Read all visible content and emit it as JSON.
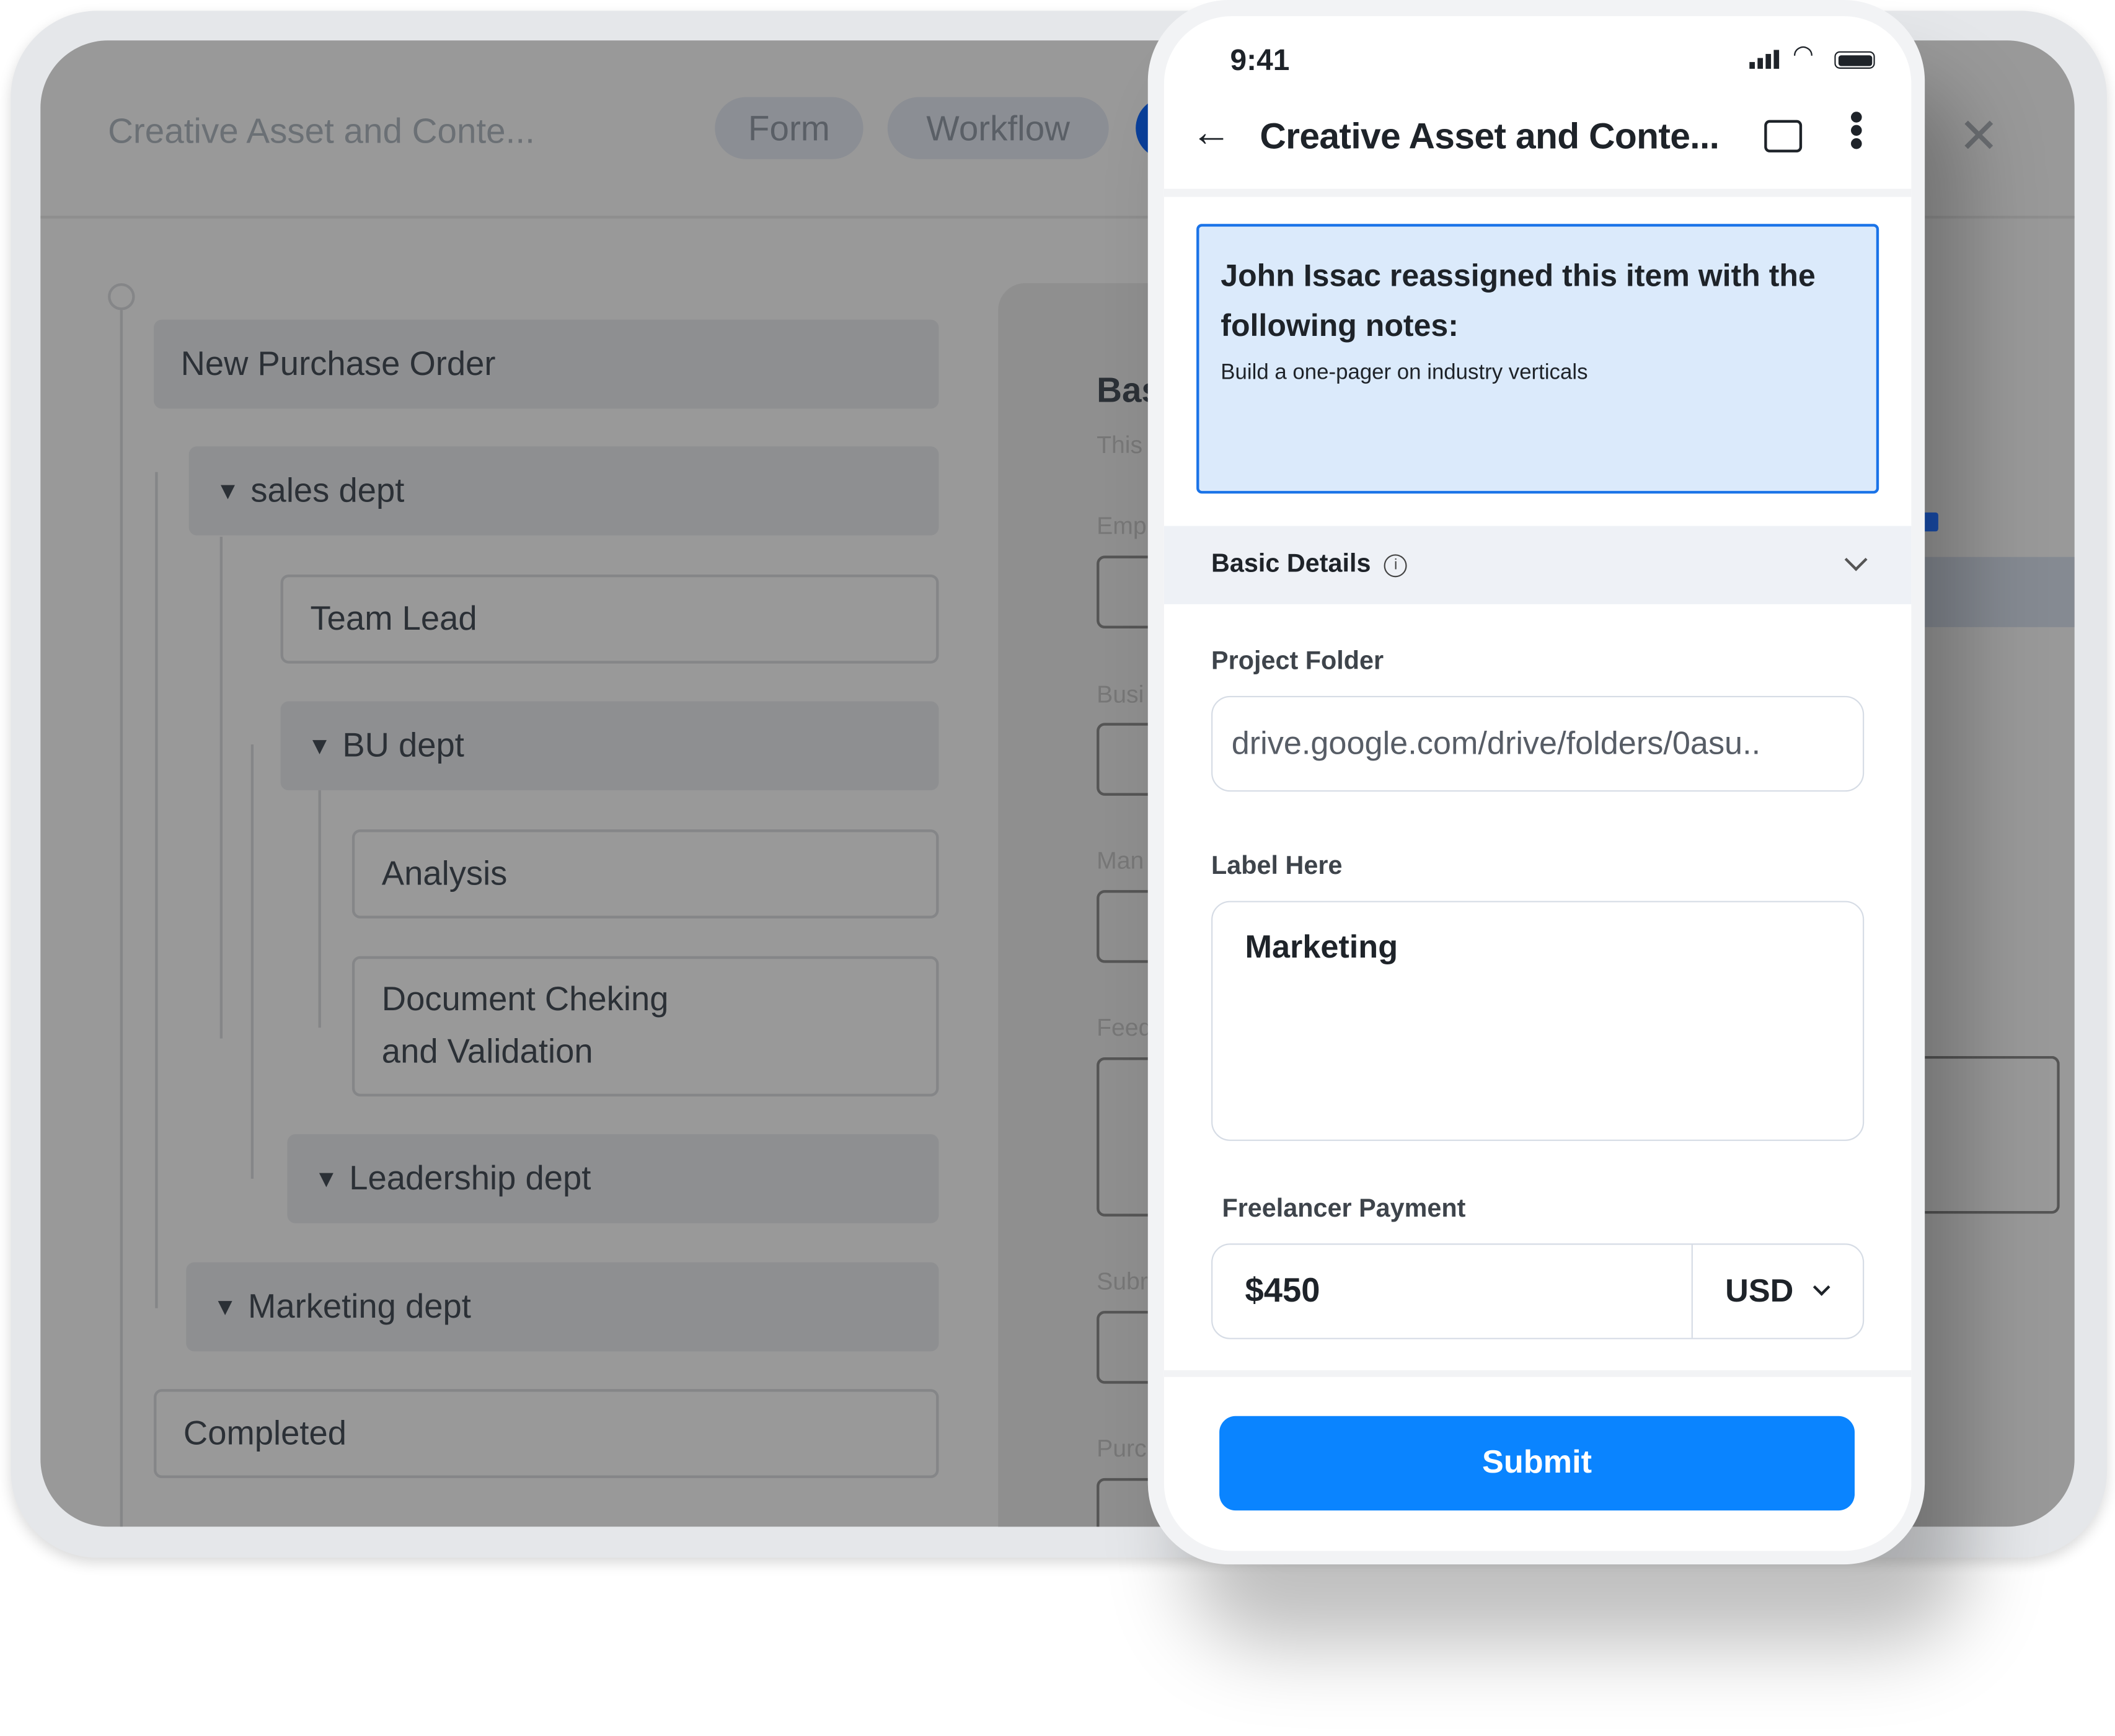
{
  "background_app": {
    "title": "Creative Asset and Conte...",
    "tabs": [
      {
        "label": "Form"
      },
      {
        "label": "Workflow"
      }
    ],
    "tree": [
      {
        "label": "New Purchase Order"
      },
      {
        "label": "sales dept"
      },
      {
        "label": "Team Lead"
      },
      {
        "label": "BU dept"
      },
      {
        "label": "Analysis"
      },
      {
        "label": "Document Cheking and Validation"
      },
      {
        "label": "Leadership dept"
      },
      {
        "label": "Marketing dept"
      },
      {
        "label": "Completed"
      }
    ],
    "panel": {
      "heading": "Bas",
      "subtitle": "This",
      "fields": [
        "Emp",
        "Busi",
        "Man",
        "Feed",
        "Subr",
        "Purc"
      ]
    }
  },
  "phone": {
    "status": {
      "time": "9:41"
    },
    "header": {
      "title": "Creative Asset and Conte..."
    },
    "notes": {
      "heading": "John Issac reassigned this item with the following notes:",
      "body": "Build a one-pager on industry verticals"
    },
    "section": {
      "title": "Basic Details"
    },
    "fields": {
      "project_folder": {
        "label": "Project Folder",
        "value": "drive.google.com/drive/folders/0asu.."
      },
      "label_here": {
        "label": "Label Here",
        "value": "Marketing"
      },
      "payment": {
        "label": "Freelancer Payment",
        "value": "$450",
        "currency": "USD"
      }
    },
    "submit_label": "Submit",
    "colors": {
      "primary": "#0a84ff",
      "notes_bg": "#dbeafb",
      "notes_border": "#1a73e8"
    }
  }
}
